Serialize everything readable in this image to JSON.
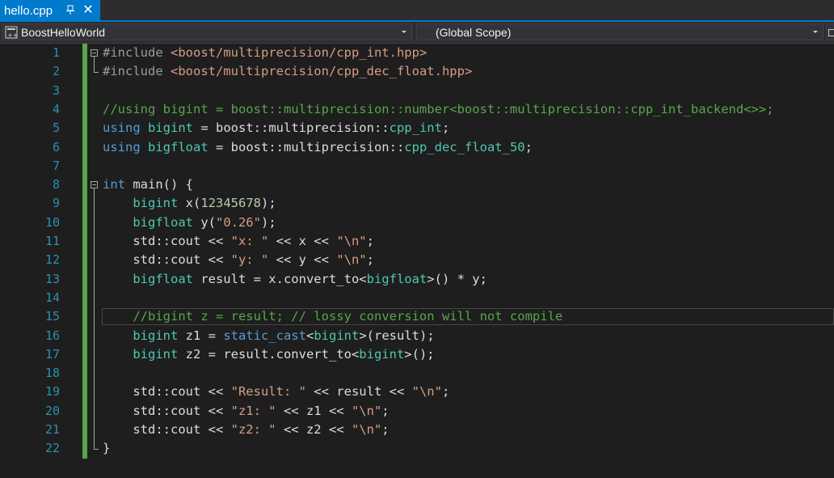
{
  "tab": {
    "title": "hello.cpp",
    "pin_icon": "pin-icon",
    "close_glyph": "✕"
  },
  "navbar": {
    "project": "BoostHelloWorld",
    "scope": "(Global Scope)"
  },
  "colors": {
    "accent": "#007acc",
    "line_number": "#2b91af",
    "change_bar": "#57a64a",
    "keyword": "#569cd6",
    "type": "#4ec9b0",
    "string": "#d69d85",
    "comment": "#57a64a",
    "number": "#b5cea8"
  },
  "editor": {
    "current_line": 15,
    "lines": [
      {
        "n": "1",
        "tokens": [
          [
            "pp",
            "#include "
          ],
          [
            "inc",
            "<boost/multiprecision/cpp_int.hpp>"
          ]
        ]
      },
      {
        "n": "2",
        "tokens": [
          [
            "pp",
            "#include "
          ],
          [
            "inc",
            "<boost/multiprecision/cpp_dec_float.hpp>"
          ]
        ]
      },
      {
        "n": "3",
        "tokens": []
      },
      {
        "n": "4",
        "tokens": [
          [
            "cm",
            "//using bigint = boost::multiprecision::number<boost::multiprecision::cpp_int_backend<>>;"
          ]
        ]
      },
      {
        "n": "5",
        "tokens": [
          [
            "kw",
            "using "
          ],
          [
            "ty",
            "bigint"
          ],
          [
            "pl",
            " = boost::multiprecision::"
          ],
          [
            "ty",
            "cpp_int"
          ],
          [
            "pl",
            ";"
          ]
        ]
      },
      {
        "n": "6",
        "tokens": [
          [
            "kw",
            "using "
          ],
          [
            "ty",
            "bigfloat"
          ],
          [
            "pl",
            " = boost::multiprecision::"
          ],
          [
            "ty",
            "cpp_dec_float_50"
          ],
          [
            "pl",
            ";"
          ]
        ]
      },
      {
        "n": "7",
        "tokens": []
      },
      {
        "n": "8",
        "tokens": [
          [
            "kw",
            "int"
          ],
          [
            "pl",
            " main() {"
          ]
        ]
      },
      {
        "n": "9",
        "tokens": [
          [
            "pl",
            "    "
          ],
          [
            "ty",
            "bigint"
          ],
          [
            "pl",
            " x("
          ],
          [
            "num",
            "12345678"
          ],
          [
            "pl",
            ");"
          ]
        ]
      },
      {
        "n": "10",
        "tokens": [
          [
            "pl",
            "    "
          ],
          [
            "ty",
            "bigfloat"
          ],
          [
            "pl",
            " y("
          ],
          [
            "str",
            "\"0.26\""
          ],
          [
            "pl",
            ");"
          ]
        ]
      },
      {
        "n": "11",
        "tokens": [
          [
            "pl",
            "    std::cout << "
          ],
          [
            "str",
            "\"x: \""
          ],
          [
            "pl",
            " << x << "
          ],
          [
            "str",
            "\"\\n\""
          ],
          [
            "pl",
            ";"
          ]
        ]
      },
      {
        "n": "12",
        "tokens": [
          [
            "pl",
            "    std::cout << "
          ],
          [
            "str",
            "\"y: \""
          ],
          [
            "pl",
            " << y << "
          ],
          [
            "str",
            "\"\\n\""
          ],
          [
            "pl",
            ";"
          ]
        ]
      },
      {
        "n": "13",
        "tokens": [
          [
            "pl",
            "    "
          ],
          [
            "ty",
            "bigfloat"
          ],
          [
            "pl",
            " result = x.convert_to<"
          ],
          [
            "ty",
            "bigfloat"
          ],
          [
            "pl",
            ">() * y;"
          ]
        ]
      },
      {
        "n": "14",
        "tokens": []
      },
      {
        "n": "15",
        "tokens": [
          [
            "pl",
            "    "
          ],
          [
            "cm",
            "//bigint z = result; // lossy conversion will not compile"
          ]
        ]
      },
      {
        "n": "16",
        "tokens": [
          [
            "pl",
            "    "
          ],
          [
            "ty",
            "bigint"
          ],
          [
            "pl",
            " z1 = "
          ],
          [
            "kw",
            "static_cast"
          ],
          [
            "pl",
            "<"
          ],
          [
            "ty",
            "bigint"
          ],
          [
            "pl",
            ">(result);"
          ]
        ]
      },
      {
        "n": "17",
        "tokens": [
          [
            "pl",
            "    "
          ],
          [
            "ty",
            "bigint"
          ],
          [
            "pl",
            " z2 = result.convert_to<"
          ],
          [
            "ty",
            "bigint"
          ],
          [
            "pl",
            ">();"
          ]
        ]
      },
      {
        "n": "18",
        "tokens": []
      },
      {
        "n": "19",
        "tokens": [
          [
            "pl",
            "    std::cout << "
          ],
          [
            "str",
            "\"Result: \""
          ],
          [
            "pl",
            " << result << "
          ],
          [
            "str",
            "\"\\n\""
          ],
          [
            "pl",
            ";"
          ]
        ]
      },
      {
        "n": "20",
        "tokens": [
          [
            "pl",
            "    std::cout << "
          ],
          [
            "str",
            "\"z1: \""
          ],
          [
            "pl",
            " << z1 << "
          ],
          [
            "str",
            "\"\\n\""
          ],
          [
            "pl",
            ";"
          ]
        ]
      },
      {
        "n": "21",
        "tokens": [
          [
            "pl",
            "    std::cout << "
          ],
          [
            "str",
            "\"z2: \""
          ],
          [
            "pl",
            " << z2 << "
          ],
          [
            "str",
            "\"\\n\""
          ],
          [
            "pl",
            ";"
          ]
        ]
      },
      {
        "n": "22",
        "tokens": [
          [
            "pl",
            "}"
          ]
        ]
      }
    ]
  }
}
